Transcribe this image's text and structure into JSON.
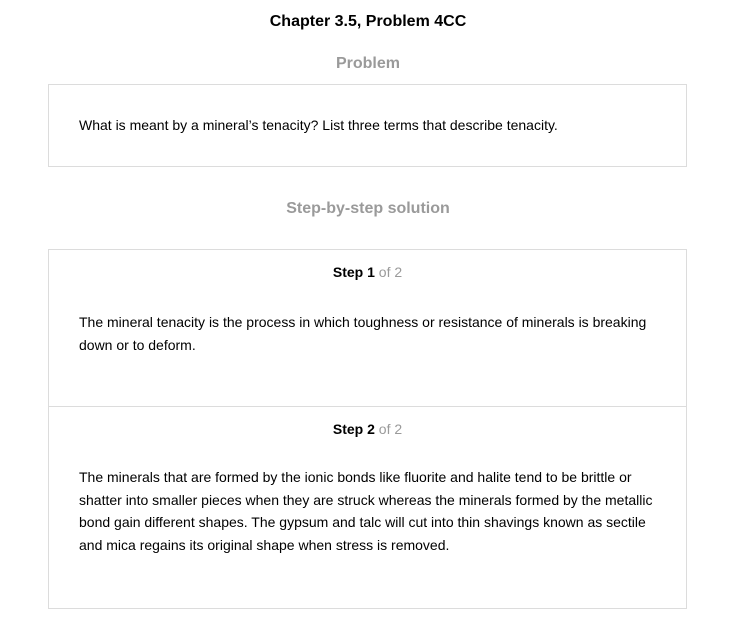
{
  "title": "Chapter 3.5, Problem 4CC",
  "problem": {
    "heading": "Problem",
    "text": "What is meant by a mineral’s tenacity? List three terms that describe tenacity."
  },
  "solution": {
    "heading": "Step-by-step solution",
    "step_word": "Step",
    "steps": [
      {
        "number": "1",
        "of_text": "of 2",
        "text": "The mineral tenacity is the process in which toughness or resistance of minerals is breaking down or to deform."
      },
      {
        "number": "2",
        "of_text": "of 2",
        "text": "The minerals that are formed by the ionic bonds like fluorite and halite tend to be brittle or shatter into smaller pieces when they are struck whereas the minerals formed by the metallic bond gain different shapes. The gypsum and talc will cut into thin shavings known as sectile and mica regains its original shape when stress is removed."
      }
    ]
  }
}
